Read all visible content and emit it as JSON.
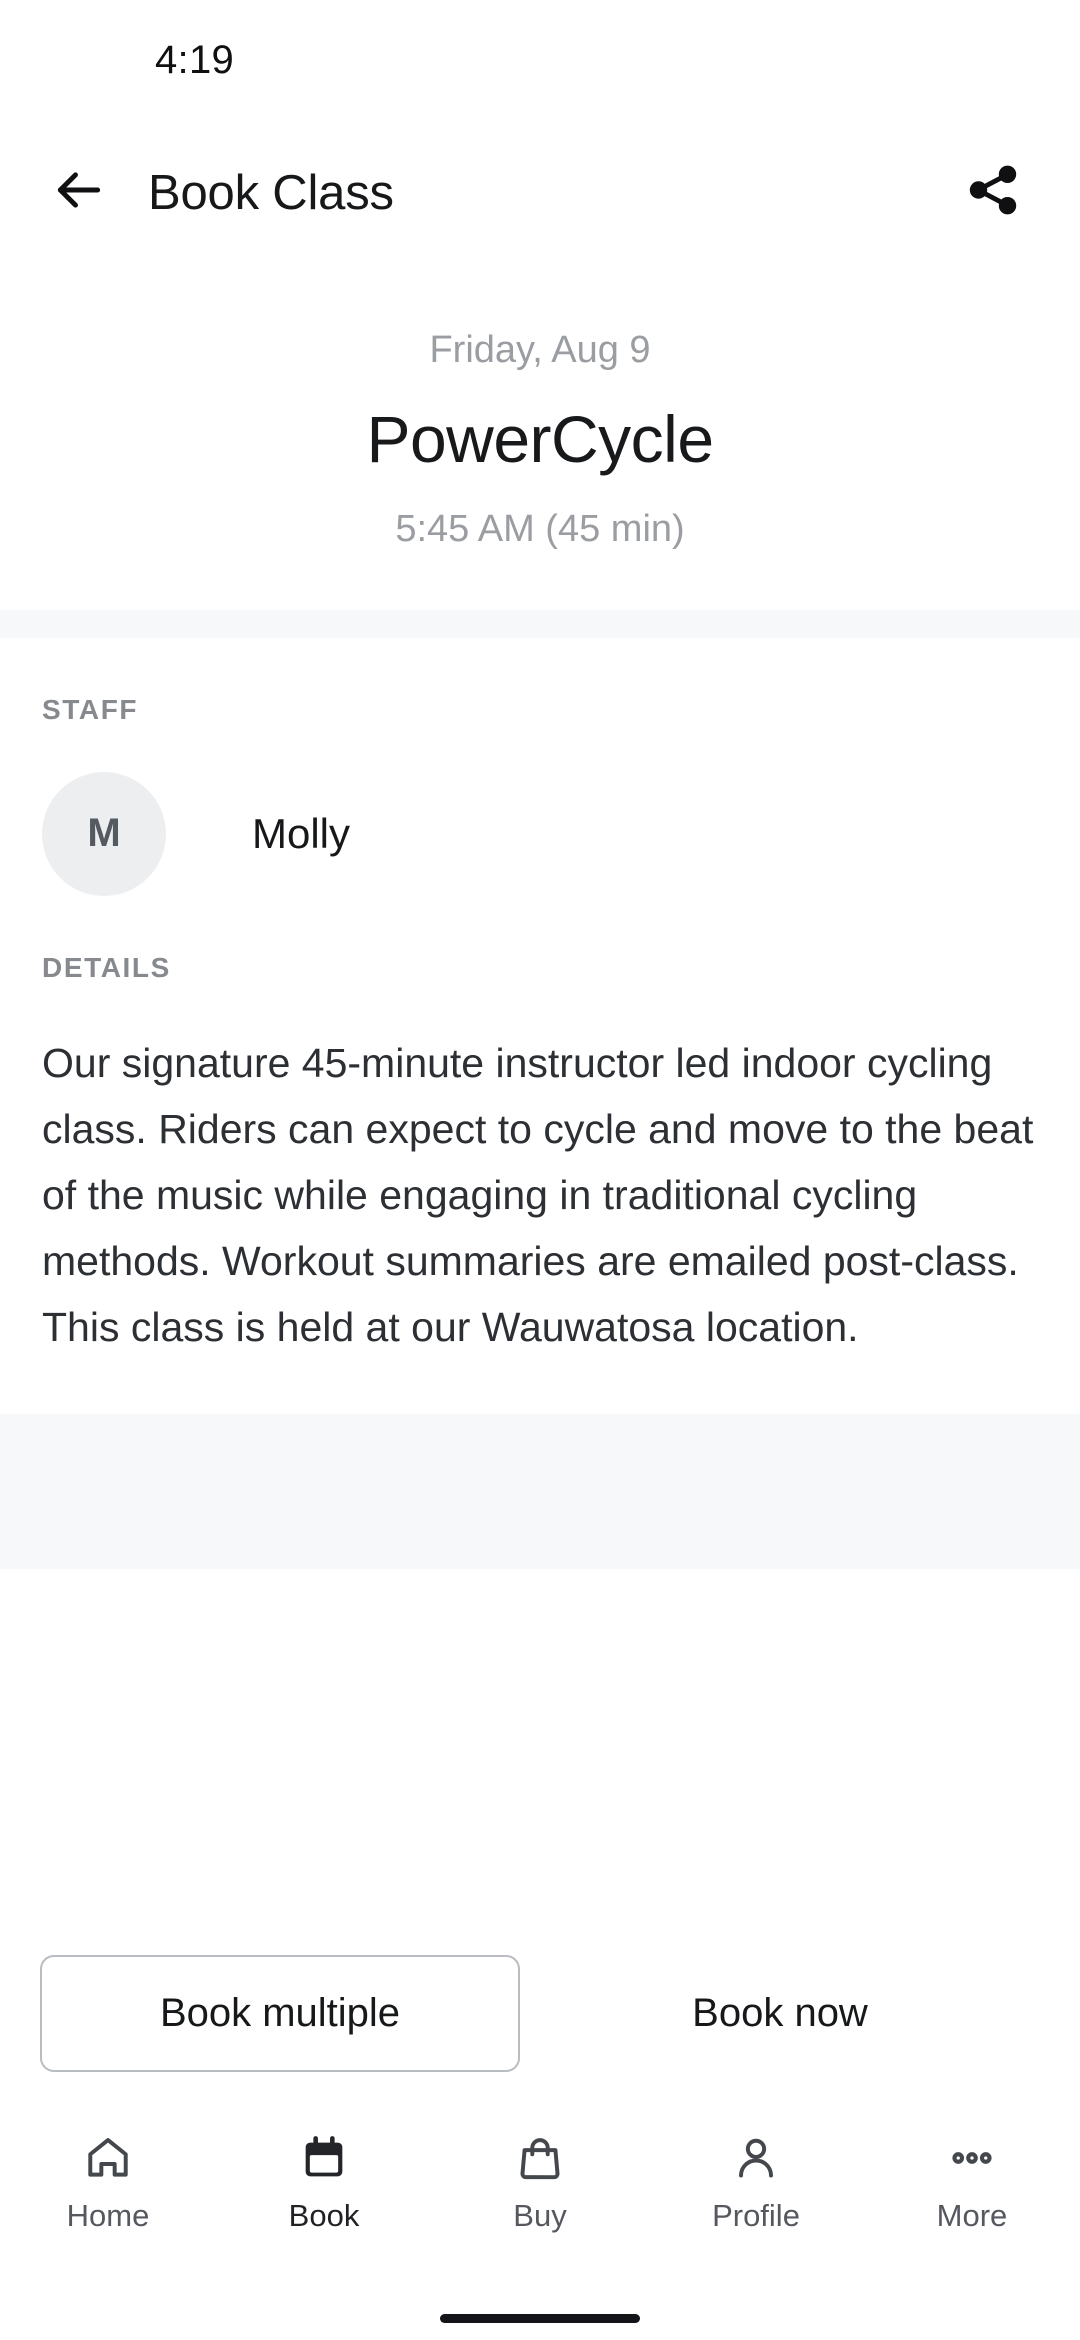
{
  "status_bar": {
    "time": "4:19"
  },
  "app_bar": {
    "back_icon": "arrow-left-icon",
    "title": "Book Class",
    "share_icon": "share-icon"
  },
  "hero": {
    "date": "Friday, Aug 9",
    "class_name": "PowerCycle",
    "time_duration": "5:45 AM (45 min)"
  },
  "staff": {
    "label": "STAFF",
    "avatar_initial": "M",
    "name": "Molly"
  },
  "details": {
    "label": "DETAILS",
    "body": "Our signature 45-minute instructor led indoor cycling class. Riders can expect to cycle and move to the beat of the music while engaging in traditional cycling methods. Workout summaries are emailed post-class. This class is held at our Wauwatosa location."
  },
  "actions": {
    "book_multiple_label": "Book multiple",
    "book_now_label": "Book now"
  },
  "bottom_nav": {
    "items": [
      {
        "label": "Home",
        "icon": "home-icon",
        "active": false
      },
      {
        "label": "Book",
        "icon": "calendar-icon",
        "active": true
      },
      {
        "label": "Buy",
        "icon": "shopping-bag-icon",
        "active": false
      },
      {
        "label": "Profile",
        "icon": "person-icon",
        "active": false
      },
      {
        "label": "More",
        "icon": "more-dots-icon",
        "active": false
      }
    ]
  },
  "colors": {
    "background": "#ffffff",
    "band": "#f6f8fa",
    "primary_text": "#16181a",
    "secondary_text": "#9a9da1",
    "label_text": "#86898d",
    "avatar_bg": "#eceef0",
    "border": "#b9bcc0",
    "nav_icon": "#44484d"
  }
}
